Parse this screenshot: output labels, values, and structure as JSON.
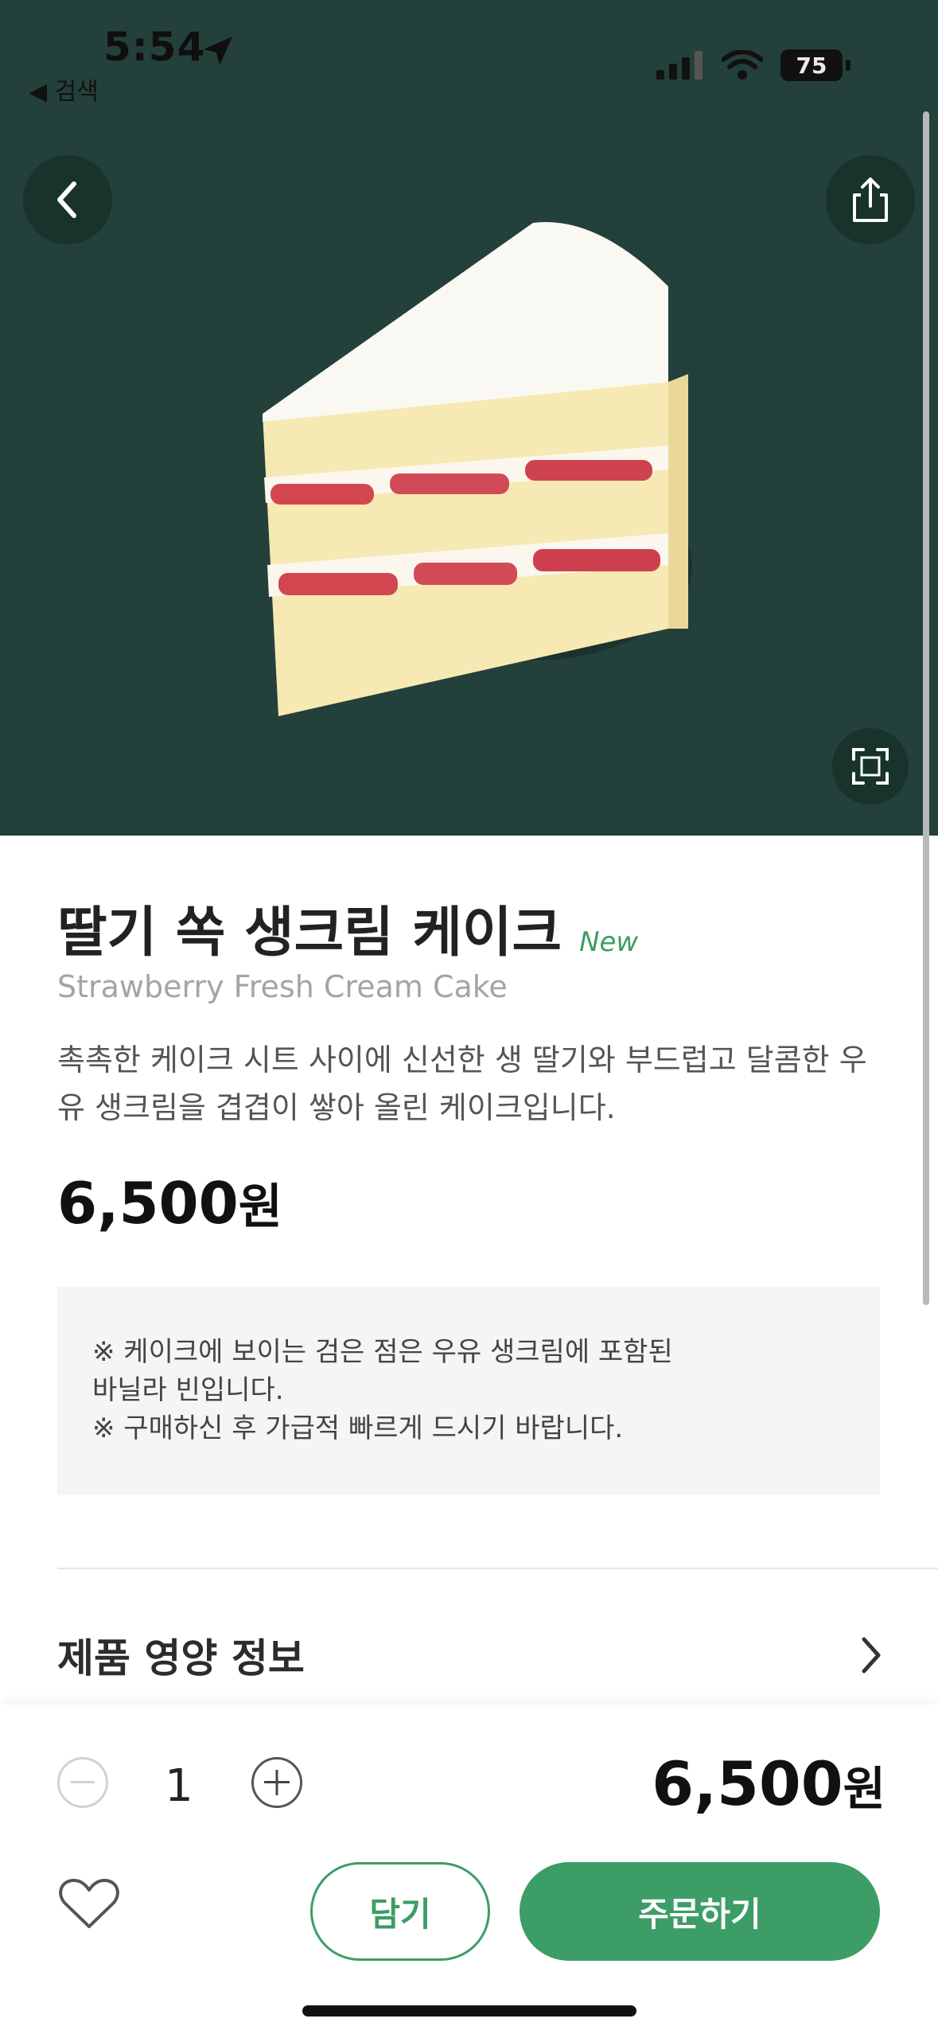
{
  "status_bar": {
    "time": "5:54",
    "back_app_label": "◀ 검색",
    "battery": "75"
  },
  "icons": {
    "location": "location-arrow-icon",
    "signal": "cellular-signal-icon",
    "wifi": "wifi-icon",
    "battery": "battery-icon",
    "back": "chevron-left-icon",
    "share": "share-icon",
    "expand": "expand-icon",
    "nutrition_arrow": "chevron-right-icon",
    "minus": "minus-circle-icon",
    "plus": "plus-circle-icon",
    "favorite": "heart-outline-icon",
    "product_image": "strawberry-cake-image"
  },
  "colors": {
    "hero_background": "#24403a",
    "accent_green": "#3c9d66",
    "notice_background": "#f5f5f5"
  },
  "product": {
    "name_ko": "딸기 쏙 생크림 케이크",
    "badge": "New",
    "name_en": "Strawberry Fresh Cream Cake",
    "description": "촉촉한 케이크 시트 사이에 신선한 생 딸기와 부드럽고 달콤한 우유 생크림을 겹겹이 쌓아 올린 케이크입니다.",
    "price_amount": "6,500",
    "price_unit": "원",
    "notice_lines": [
      "※ 케이크에 보이는 검은 점은 우유 생크림에 포함된",
      "바닐라 빈입니다.",
      "※ 구매하신 후 가급적 빠르게 드시기 바랍니다."
    ]
  },
  "nutrition": {
    "label": "제품 영양 정보"
  },
  "order": {
    "quantity": "1",
    "total_amount": "6,500",
    "total_unit": "원",
    "cart_label": "담기",
    "order_label": "주문하기"
  }
}
